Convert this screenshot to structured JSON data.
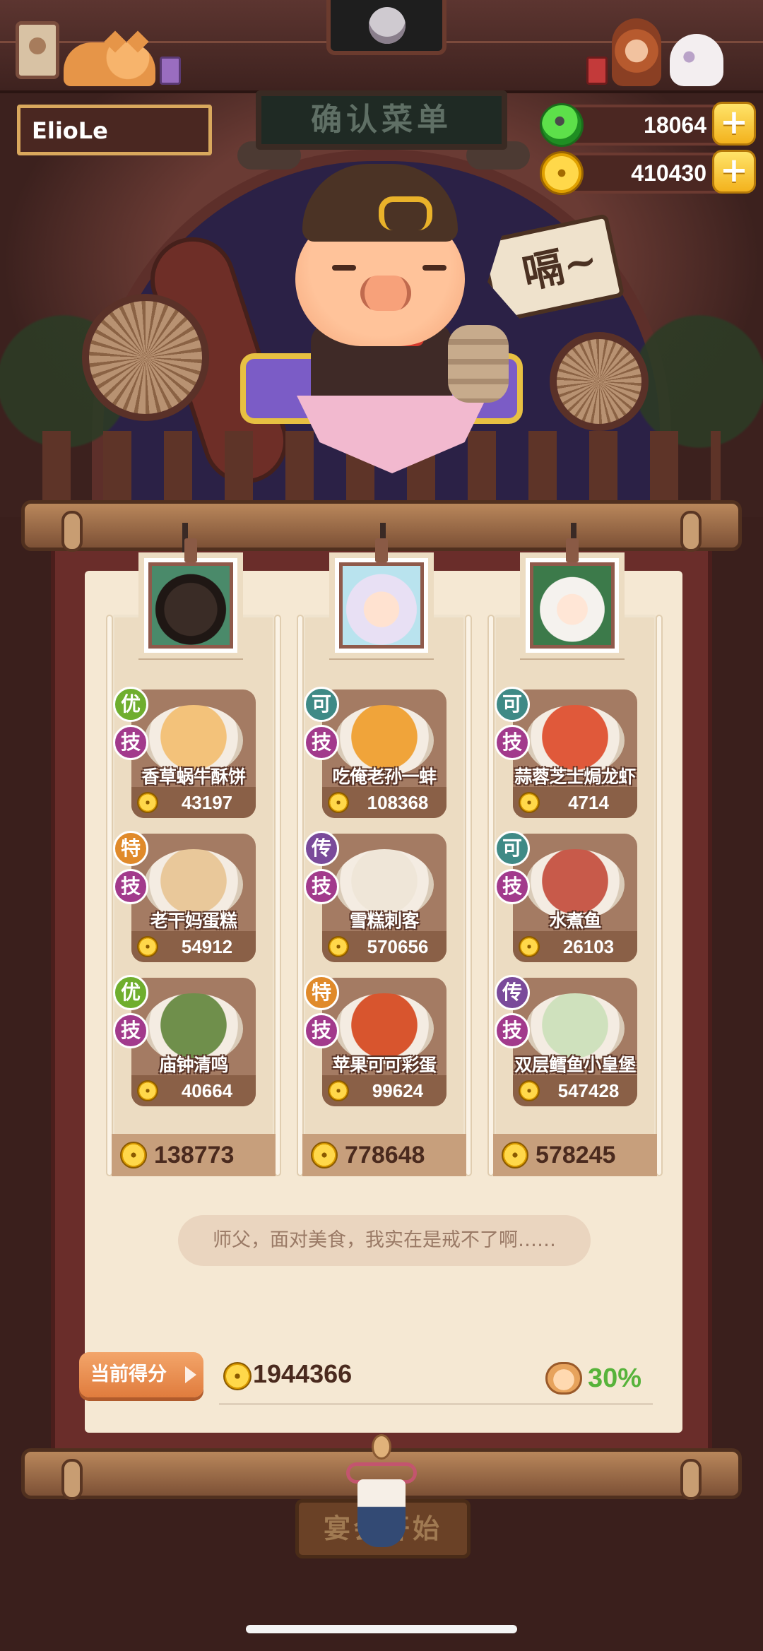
{
  "player": {
    "name": "ElioLe"
  },
  "currency": {
    "jade": "18064",
    "coins": "410430",
    "plus": "+"
  },
  "banner": {
    "title": "确认菜单"
  },
  "speech": {
    "text": "嗝~"
  },
  "columns": [
    {
      "total": "138773",
      "dishes": [
        {
          "rank": "优",
          "rank_color": "#6fae2e",
          "skill": "技",
          "name": "香草蜗牛酥饼",
          "score": "43197",
          "plate": "#f3c27a"
        },
        {
          "rank": "特",
          "rank_color": "#e08a2a",
          "skill": "技",
          "name": "老干妈蛋糕",
          "score": "54912",
          "plate": "#e9c89a"
        },
        {
          "rank": "优",
          "rank_color": "#6fae2e",
          "skill": "技",
          "name": "庙钟清鸣",
          "score": "40664",
          "plate": "#6f8f4b"
        }
      ]
    },
    {
      "total": "778648",
      "dishes": [
        {
          "rank": "可",
          "rank_color": "#3f8a86",
          "skill": "技",
          "name": "吃俺老孙一蚌",
          "score": "108368",
          "plate": "#f0a43a"
        },
        {
          "rank": "传",
          "rank_color": "#7a4a9a",
          "skill": "技",
          "name": "雪糕刺客",
          "score": "570656",
          "plate": "#efe6d8"
        },
        {
          "rank": "特",
          "rank_color": "#e08a2a",
          "skill": "技",
          "name": "苹果可可彩蛋",
          "score": "99624",
          "plate": "#d8552e"
        }
      ]
    },
    {
      "total": "578245",
      "dishes": [
        {
          "rank": "可",
          "rank_color": "#3f8a86",
          "skill": "技",
          "name": "蒜蓉芝士焗龙虾",
          "score": "4714",
          "plate": "#e0593a"
        },
        {
          "rank": "可",
          "rank_color": "#3f8a86",
          "skill": "技",
          "name": "水煮鱼",
          "score": "26103",
          "plate": "#c85a4a"
        },
        {
          "rank": "传",
          "rank_color": "#7a4a9a",
          "skill": "技",
          "name": "双层鳕鱼小皇堡",
          "score": "547428",
          "plate": "#cfe1bd"
        }
      ]
    }
  ],
  "quote": {
    "text": "师父，面对美食，我实在是戒不了啊……"
  },
  "score": {
    "label": "当前得分",
    "value": "1944366",
    "bonus": "30%"
  },
  "start_button": {
    "label": "宴会开始"
  },
  "colors": {
    "accent_gold": "#f3b21d",
    "board": "#6a2d2a",
    "parchment": "#f5e8d3",
    "bonus_green": "#57b33a"
  },
  "icons": [
    "jade-coin-icon",
    "gold-coin-icon",
    "plus-icon",
    "bonus-pig-icon",
    "play-arrow-icon"
  ]
}
